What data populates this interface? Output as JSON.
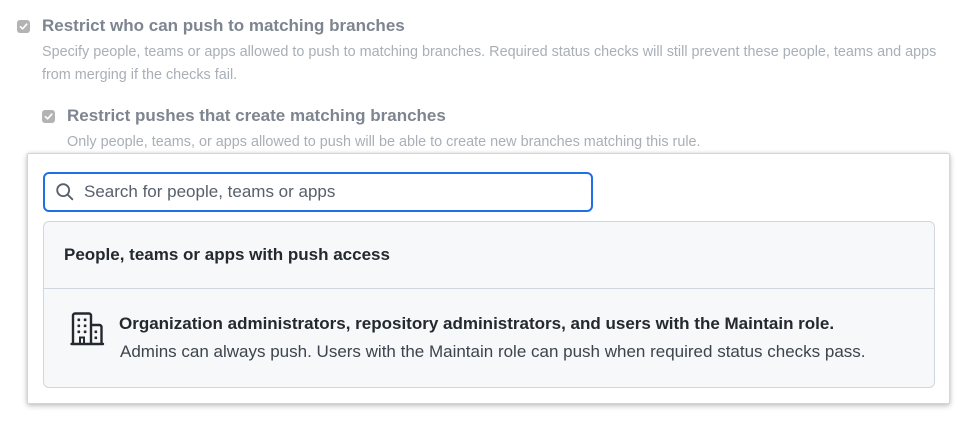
{
  "options": [
    {
      "checked": true,
      "title": "Restrict who can push to matching branches",
      "description": "Specify people, teams or apps allowed to push to matching branches. Required status checks will still prevent these people, teams and apps from merging if the checks fail."
    },
    {
      "checked": true,
      "title": "Restrict pushes that create matching branches",
      "description": "Only people, teams, or apps allowed to push will be able to create new branches matching this rule."
    }
  ],
  "popover": {
    "search": {
      "placeholder": "Search for people, teams or apps",
      "value": "",
      "icon": "search-icon"
    },
    "list": {
      "header": "People, teams or apps with push access",
      "items": [
        {
          "icon": "organization-icon",
          "title": "Organization administrators, repository administrators, and users with the Maintain role.",
          "description": "Admins can always push. Users with the Maintain role can push when required status checks pass."
        }
      ]
    }
  },
  "colors": {
    "focus_border": "#1f6feb",
    "disabled_text": "#7d8590",
    "list_background": "#f6f8fa",
    "border": "#d0d7de"
  }
}
